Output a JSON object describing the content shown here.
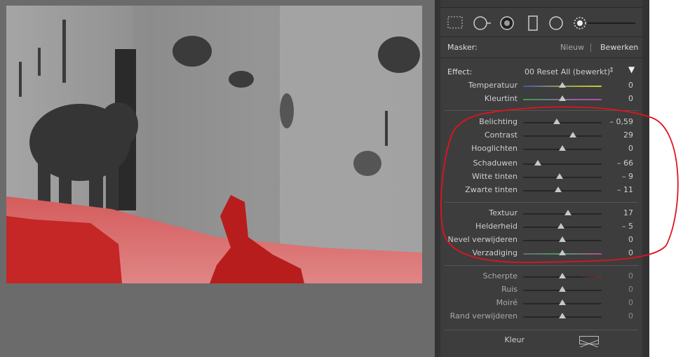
{
  "mask": {
    "label": "Masker:",
    "new_label": "Nieuw",
    "edit_label": "Bewerken"
  },
  "effect": {
    "label": "Effect:",
    "value": "00 Reset All (bewerkt)",
    "stepper": "⇕",
    "toggle": "▼"
  },
  "sliders": [
    {
      "label": "Temperatuur",
      "value": "0",
      "pos": 0.5
    },
    {
      "label": "Kleurtint",
      "value": "0",
      "pos": 0.5
    },
    {
      "label": "Belichting",
      "value": "– 0,59",
      "pos": 0.43
    },
    {
      "label": "Contrast",
      "value": "29",
      "pos": 0.63
    },
    {
      "label": "Hooglichten",
      "value": "0",
      "pos": 0.5
    },
    {
      "label": "Schaduwen",
      "value": "– 66",
      "pos": 0.19
    },
    {
      "label": "Witte tinten",
      "value": "– 9",
      "pos": 0.46
    },
    {
      "label": "Zwarte tinten",
      "value": "– 11",
      "pos": 0.45
    },
    {
      "label": "Textuur",
      "value": "17",
      "pos": 0.57
    },
    {
      "label": "Helderheid",
      "value": "– 5",
      "pos": 0.48
    },
    {
      "label": "Nevel verwijderen",
      "value": "0",
      "pos": 0.5
    },
    {
      "label": "Verzadiging",
      "value": "0",
      "pos": 0.5
    },
    {
      "label": "Scherpte",
      "value": "0",
      "pos": 0.5
    },
    {
      "label": "Ruis",
      "value": "0",
      "pos": 0.5
    },
    {
      "label": "Moiré",
      "value": "0",
      "pos": 0.5
    },
    {
      "label": "Rand verwijderen",
      "value": "0",
      "pos": 0.5
    }
  ],
  "color": {
    "label": "Kleur"
  },
  "icons": [
    "mask-brush-icon",
    "circle-arrow-icon",
    "radial-filter-icon",
    "graduated-filter-icon",
    "circle-icon",
    "brush-size-icon"
  ],
  "colors": {
    "annotation": "#e0141e",
    "mask_overlay": "#d22828",
    "panel": "#3d3d3d"
  }
}
